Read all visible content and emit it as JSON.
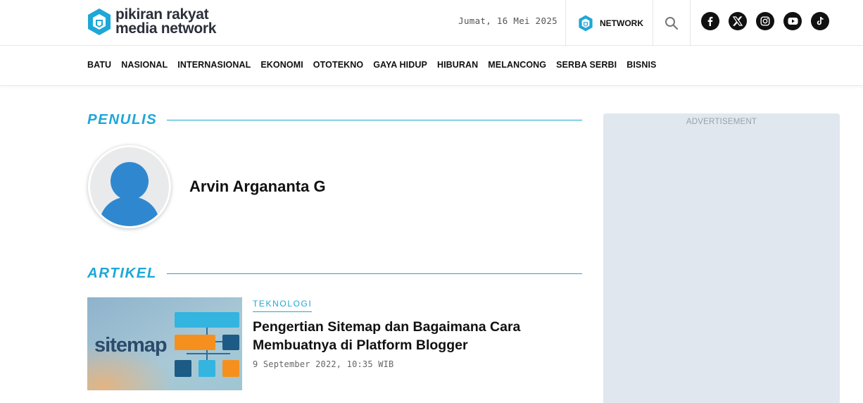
{
  "header": {
    "logo_line1": "pikiran rakyat",
    "logo_line2": "media network",
    "date": "Jumat, 16 Mei 2025",
    "network_label": "NETWORK",
    "brand_color": "#1ea7d9",
    "social_icons": [
      "facebook-icon",
      "x-icon",
      "instagram-icon",
      "youtube-icon",
      "tiktok-icon"
    ]
  },
  "nav": {
    "items": [
      "BATU",
      "NASIONAL",
      "INTERNASIONAL",
      "EKONOMI",
      "OTOTEKNO",
      "GAYA HIDUP",
      "HIBURAN",
      "MELANCONG",
      "SERBA SERBI",
      "BISNIS"
    ]
  },
  "writer_section": {
    "heading": "PENULIS",
    "name": "Arvin Argananta G"
  },
  "articles_section": {
    "heading": "ARTIKEL",
    "items": [
      {
        "category": "TEKNOLOGI",
        "title": "Pengertian Sitemap dan Bagaimana Cara Membuatnya di Platform Blogger",
        "date": "9 September 2022, 10:35 WIB",
        "thumb_text": "sitemap"
      }
    ]
  },
  "ad": {
    "label": "ADVERTISEMENT"
  }
}
